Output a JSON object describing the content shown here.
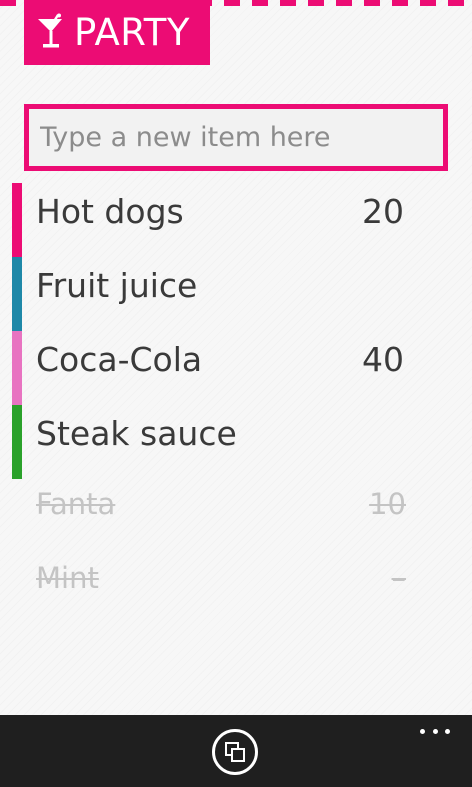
{
  "header": {
    "title": "PARTY",
    "icon": "cocktail-glass-icon",
    "accent_color": "#ec0c74"
  },
  "new_item": {
    "placeholder": "Type a new item here",
    "value": ""
  },
  "items": [
    {
      "name": "Hot dogs",
      "quantity": "20",
      "color": "#ec0c74",
      "done": false
    },
    {
      "name": "Fruit juice",
      "quantity": "",
      "color": "#1e88a8",
      "done": false
    },
    {
      "name": "Coca-Cola",
      "quantity": "40",
      "color": "#e873c1",
      "done": false
    },
    {
      "name": "Steak sauce",
      "quantity": "",
      "color": "#2aa12a",
      "done": false
    },
    {
      "name": "Fanta",
      "quantity": "10",
      "color": "",
      "done": true
    },
    {
      "name": "Mint",
      "quantity": "–",
      "color": "",
      "done": true
    }
  ],
  "app_bar": {
    "button_icon": "switch-list-icon",
    "more_icon": "more-options-icon",
    "background": "#1f1f1f"
  }
}
